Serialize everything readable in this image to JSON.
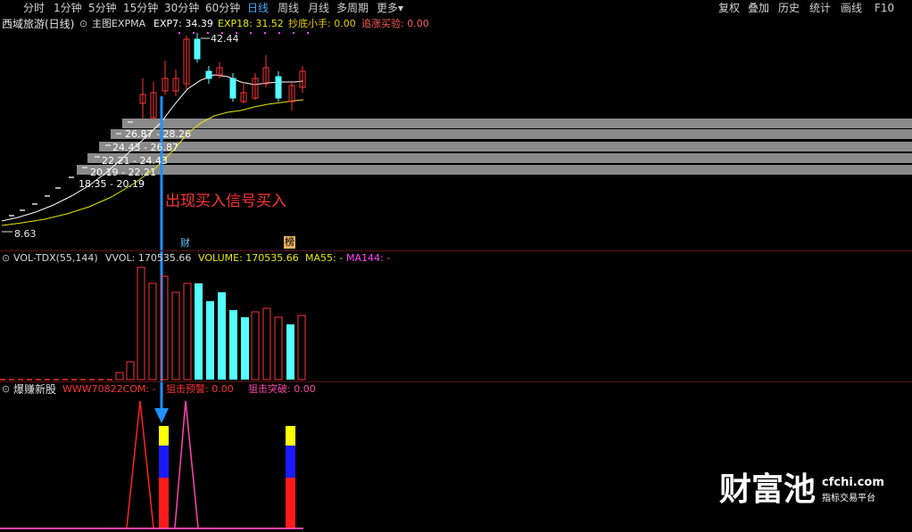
{
  "toolbar": {
    "periods": [
      "分时",
      "1分钟",
      "5分钟",
      "15分钟",
      "30分钟",
      "60分钟",
      "日线",
      "周线",
      "月线",
      "多周期",
      "更多"
    ],
    "more_arrow": "▾",
    "actions": [
      "复权",
      "叠加",
      "历史",
      "统计",
      "画线",
      "F10"
    ],
    "active_period": "日线"
  },
  "main_panel": {
    "stock_title": "西域旅游(日线)",
    "indicator_name": "主图EXPMA",
    "exp7": "EXP7: 34.39",
    "exp18": "EXP18: 31.52",
    "dip_buyer": "抄底小手: 0.00",
    "chase_up": "追涨买验: 0.00",
    "high_label": "42.44",
    "low_label": "8.63",
    "price_ranges": [
      "26.87 - 28.26",
      "24.43 - 26.87",
      "22.21 - 24.43",
      "20.19 - 22.21",
      "18.35 - 20.19"
    ],
    "markers": [
      "财",
      "榜"
    ],
    "annotation": "出现买入信号买入"
  },
  "volume_panel": {
    "indicator": "VOL-TDX(55,144)",
    "vvol": "VVOL: 170535.66",
    "volume": "VOLUME: 170535.66",
    "ma55": "MA55: -",
    "ma144": "MA144: -"
  },
  "signal_panel": {
    "name": "爆赚新股",
    "site": "WWW70822COM: -",
    "warning": "狙击预警: 0.00",
    "breakout": "狙击突破: 0.00"
  },
  "watermark": {
    "brand": "财富池",
    "domain": "cfchi.com",
    "tagline": "指标交易平台"
  },
  "colors": {
    "up": "#ff3333",
    "down": "#54ffff",
    "exp7": "#ffffff",
    "exp18": "#e8e800",
    "annotation": "#ff3333",
    "arrow": "#1e90ff",
    "ma144": "#ff44ff"
  },
  "chart_data": {
    "type": "candlestick",
    "price_labels": {
      "high": 42.44,
      "low": 8.63
    },
    "volume_series": [
      {
        "name": "VOLUME",
        "value": 170535.66
      }
    ]
  }
}
